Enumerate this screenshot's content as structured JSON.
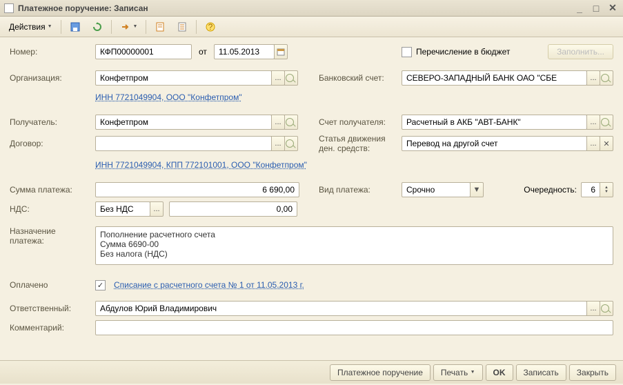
{
  "window": {
    "title": "Платежное поручение: Записан"
  },
  "toolbar": {
    "actions": "Действия"
  },
  "labels": {
    "number": "Номер:",
    "from": "от",
    "org": "Организация:",
    "recipient": "Получатель:",
    "contract": "Договор:",
    "amount": "Сумма платежа:",
    "vat": "НДС:",
    "purpose1": "Назначение",
    "purpose2": "платежа:",
    "paid": "Оплачено",
    "responsible": "Ответственный:",
    "comment": "Комментарий:",
    "budget": "Перечисление в бюджет",
    "bank_acc": "Банковский счет:",
    "recip_acc": "Счет получателя:",
    "flow1": "Статья движения",
    "flow2": "ден. средств:",
    "pay_type": "Вид платежа:",
    "priority": "Очередность:",
    "fill": "Заполнить..."
  },
  "values": {
    "number": "КФП00000001",
    "date": "11.05.2013",
    "org": "Конфетпром",
    "org_link": "ИНН 7721049904, ООО \"Конфетпром\"",
    "recipient": "Конфетпром",
    "contract": "",
    "recip_link": "ИНН 7721049904, КПП 772101001, ООО \"Конфетпром\"",
    "amount": "6 690,00",
    "vat_type": "Без НДС",
    "vat_amount": "0,00",
    "purpose": "Пополнение расчетного счета\nСумма 6690-00\nБез налога (НДС)",
    "paid_link": "Списание с расчетного счета № 1 от 11.05.2013 г.",
    "responsible": "Абдулов Юрий Владимирович",
    "comment": "",
    "bank_acc": "СЕВЕРО-ЗАПАДНЫЙ БАНК ОАО \"СБЕ",
    "recip_acc": "Расчетный в АКБ \"АВТ-БАНК\"",
    "flow": "Перевод на другой счет",
    "pay_type": "Срочно",
    "priority": "6"
  },
  "footer": {
    "doc": "Платежное поручение",
    "print": "Печать",
    "ok": "OK",
    "save": "Записать",
    "close": "Закрыть"
  }
}
